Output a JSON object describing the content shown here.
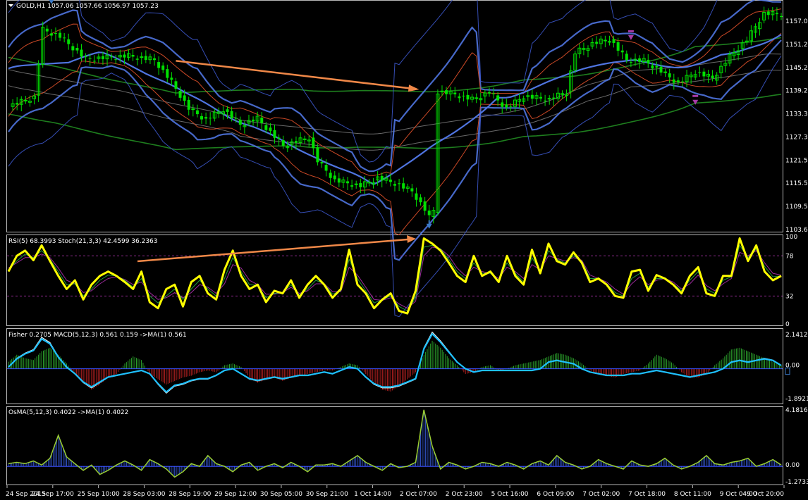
{
  "colors": {
    "background": "#000000",
    "panel_border": "#b8b8b8",
    "bull_candle": "#00e000",
    "bb_inner": "#4f74e0",
    "bb_outer": "#3b55c8",
    "bb_red": "#e0502a",
    "ma_long_green": "#1e7e1e",
    "ma_long_gray": "#6a6a6a",
    "arrow_orange": "#f08848",
    "rsi_yellow": "#ffff00",
    "stoch_green": "#1f9a3a",
    "stoch_purple": "#9a2a9a",
    "hist_pos": "#2ba02b",
    "hist_neg": "#b02020",
    "fisher_cyan": "#1ec0ff",
    "osma_line": "#9acd32",
    "osma_hist": "#3050c0",
    "zero_line": "#3a50ff",
    "level_line": "#8a2a8a"
  },
  "icons": [
    "dropdown-triangle-icon",
    "buy-arrow-icon",
    "sell-arrow-icon"
  ],
  "chart_data": [
    {
      "type": "candlestick",
      "title": "GOLD,H1  1057.06 1057.66 1056.97 1057.23",
      "yaxis_ticks": [
        "1157.09",
        "1151.29",
        "1145.29",
        "1139.29",
        "1133.39",
        "1127.39",
        "1121.59",
        "1115.59",
        "1109.59",
        "1103.69"
      ],
      "ylim": [
        1103.69,
        1160.5
      ],
      "close_path": [
        [
          0,
          1134.5
        ],
        [
          6,
          1136.8
        ],
        [
          8,
          1153.5
        ],
        [
          12,
          1151.8
        ],
        [
          18,
          1146.2
        ],
        [
          28,
          1147.0
        ],
        [
          34,
          1146.0
        ],
        [
          38,
          1140.5
        ],
        [
          42,
          1134.0
        ],
        [
          46,
          1131.2
        ],
        [
          50,
          1133.8
        ],
        [
          54,
          1130.0
        ],
        [
          58,
          1131.5
        ],
        [
          64,
          1124.8
        ],
        [
          70,
          1126.8
        ],
        [
          72,
          1121.0
        ],
        [
          76,
          1116.2
        ],
        [
          82,
          1114.8
        ],
        [
          86,
          1116.8
        ],
        [
          90,
          1115.5
        ],
        [
          94,
          1113.5
        ],
        [
          97,
          1109.0
        ],
        [
          98,
          1107.0
        ],
        [
          99,
          1108.8
        ],
        [
          100,
          1138.2
        ],
        [
          104,
          1137.5
        ],
        [
          108,
          1136.2
        ],
        [
          112,
          1138.0
        ],
        [
          116,
          1134.0
        ],
        [
          120,
          1137.0
        ],
        [
          126,
          1136.2
        ],
        [
          130,
          1138.2
        ],
        [
          132,
          1147.8
        ],
        [
          136,
          1150.0
        ],
        [
          140,
          1151.2
        ],
        [
          144,
          1146.0
        ],
        [
          148,
          1145.8
        ],
        [
          152,
          1143.2
        ],
        [
          156,
          1140.2
        ],
        [
          160,
          1143.0
        ],
        [
          164,
          1141.5
        ],
        [
          168,
          1146.8
        ],
        [
          172,
          1151.0
        ],
        [
          176,
          1157.5
        ],
        [
          180,
          1157.3
        ]
      ],
      "arrows": [
        {
          "kind": "buy",
          "x": 10,
          "y": 1159.5
        },
        {
          "kind": "buy",
          "x": 98,
          "y": 1103.9
        },
        {
          "kind": "sell",
          "x": 145,
          "y": 1152.5
        },
        {
          "kind": "sell",
          "x": 160,
          "y": 1136.5
        }
      ],
      "trend_annotation": {
        "from": [
          39,
          1145.8
        ],
        "to": [
          95,
          1138.8
        ]
      }
    },
    {
      "type": "line",
      "title": "RSI(5) 68.3993  Stoch(21,3,3) 42.4599 36.2363",
      "yaxis_ticks": [
        "100",
        "78",
        "32",
        "0"
      ],
      "ylim": [
        0,
        100
      ],
      "levels": [
        78,
        32
      ],
      "series": [
        {
          "name": "RSI(5)",
          "values": [
            60,
            78,
            84,
            73,
            90,
            72,
            55,
            40,
            50,
            28,
            45,
            55,
            60,
            55,
            48,
            40,
            60,
            25,
            18,
            40,
            45,
            20,
            48,
            55,
            35,
            28,
            62,
            84,
            55,
            40,
            45,
            25,
            38,
            35,
            50,
            30,
            45,
            55,
            45,
            30,
            40,
            85,
            45,
            35,
            18,
            28,
            35,
            15,
            12,
            38,
            98,
            92,
            84,
            70,
            55,
            48,
            78,
            55,
            60,
            48,
            78,
            55,
            45,
            85,
            58,
            92,
            72,
            68,
            82,
            70,
            48,
            52,
            45,
            32,
            30,
            60,
            62,
            38,
            56,
            52,
            45,
            35,
            55,
            65,
            35,
            32,
            55,
            55,
            98,
            72,
            90,
            60,
            50,
            55
          ]
        },
        {
          "name": "Stoch main",
          "values": [
            62,
            72,
            80,
            76,
            84,
            74,
            60,
            45,
            46,
            32,
            40,
            50,
            56,
            55,
            50,
            42,
            52,
            32,
            24,
            32,
            40,
            28,
            40,
            50,
            40,
            32,
            52,
            76,
            60,
            45,
            44,
            30,
            35,
            36,
            45,
            33,
            40,
            50,
            46,
            34,
            38,
            74,
            52,
            38,
            24,
            28,
            32,
            20,
            15,
            30,
            88,
            90,
            86,
            74,
            60,
            52,
            70,
            58,
            58,
            50,
            70,
            58,
            48,
            76,
            60,
            84,
            74,
            70,
            78,
            72,
            52,
            52,
            46,
            36,
            32,
            52,
            58,
            42,
            52,
            52,
            46,
            38,
            50,
            60,
            40,
            35,
            50,
            54,
            90,
            76,
            86,
            66,
            54,
            55
          ]
        },
        {
          "name": "Stoch signal",
          "values": [
            64,
            70,
            76,
            76,
            80,
            76,
            64,
            50,
            46,
            36,
            38,
            46,
            52,
            54,
            51,
            45,
            48,
            36,
            28,
            30,
            36,
            30,
            36,
            45,
            42,
            35,
            46,
            68,
            64,
            50,
            45,
            34,
            34,
            36,
            42,
            35,
            38,
            46,
            46,
            37,
            37,
            65,
            56,
            42,
            28,
            27,
            30,
            23,
            18,
            26,
            78,
            88,
            86,
            78,
            64,
            55,
            65,
            60,
            58,
            52,
            65,
            60,
            52,
            68,
            62,
            78,
            75,
            72,
            76,
            73,
            56,
            52,
            48,
            40,
            34,
            46,
            54,
            45,
            50,
            52,
            48,
            40,
            46,
            56,
            44,
            38,
            46,
            52,
            82,
            78,
            84,
            70,
            58,
            56
          ]
        }
      ]
    },
    {
      "type": "bar+line",
      "title": "Fisher 0.2705  MACD(5,12,3) 0.561 0.159  ->MA(1) 0.561",
      "yaxis_ticks": [
        "2.1412",
        "0.00",
        "-1.8921"
      ],
      "ylim": [
        -1.95,
        2.2
      ],
      "histogram": [
        0.4,
        0.8,
        0.6,
        0.5,
        1.0,
        1.2,
        0.8,
        0.3,
        -0.3,
        -0.8,
        -1.2,
        -0.9,
        -0.5,
        -0.3,
        0.3,
        0.7,
        0.5,
        -0.3,
        -0.6,
        -0.9,
        -0.7,
        -0.5,
        -0.4,
        -0.2,
        -0.1,
        -0.2,
        0.2,
        0.3,
        0.1,
        -0.5,
        -0.8,
        -0.6,
        -0.5,
        -0.7,
        -0.5,
        -0.4,
        -0.3,
        -0.2,
        -0.1,
        -0.1,
        0.1,
        0.3,
        0.2,
        -0.3,
        -0.8,
        -1.2,
        -1.3,
        -1.0,
        -0.6,
        -0.2,
        0.8,
        1.6,
        1.2,
        0.6,
        0.2,
        -0.3,
        -0.2,
        0.1,
        0.2,
        -0.1,
        0.0,
        0.2,
        0.3,
        0.4,
        0.5,
        0.7,
        0.9,
        0.8,
        0.6,
        0.3,
        -0.1,
        -0.3,
        -0.4,
        -0.5,
        -0.3,
        -0.2,
        -0.1,
        0.3,
        0.8,
        0.6,
        0.3,
        -0.2,
        -0.5,
        -0.5,
        -0.3,
        0.2,
        0.6,
        1.1,
        1.2,
        1.0,
        0.8,
        0.6,
        0.4,
        0.2
      ],
      "series": [
        {
          "name": "MACD",
          "values": [
            0.1,
            0.6,
            0.9,
            1.1,
            1.8,
            1.5,
            0.7,
            0.1,
            -0.3,
            -0.8,
            -1.1,
            -0.8,
            -0.5,
            -0.4,
            -0.3,
            -0.2,
            -0.1,
            -0.3,
            -0.9,
            -1.4,
            -1.0,
            -0.9,
            -0.7,
            -0.6,
            -0.6,
            -0.4,
            -0.1,
            0.0,
            -0.3,
            -0.6,
            -0.7,
            -0.6,
            -0.5,
            -0.6,
            -0.5,
            -0.4,
            -0.4,
            -0.3,
            -0.2,
            -0.3,
            -0.1,
            0.1,
            0.0,
            -0.5,
            -0.9,
            -1.1,
            -1.1,
            -1.0,
            -0.8,
            -0.6,
            1.2,
            2.1,
            1.6,
            1.0,
            0.4,
            0.0,
            -0.2,
            -0.1,
            -0.1,
            -0.1,
            -0.1,
            -0.1,
            -0.1,
            -0.1,
            0.0,
            0.4,
            0.5,
            0.4,
            0.3,
            0.0,
            -0.2,
            -0.3,
            -0.4,
            -0.4,
            -0.4,
            -0.3,
            -0.3,
            -0.2,
            -0.1,
            -0.2,
            -0.3,
            -0.4,
            -0.5,
            -0.4,
            -0.3,
            -0.2,
            0.0,
            0.4,
            0.5,
            0.4,
            0.5,
            0.6,
            0.5,
            0.2
          ]
        }
      ]
    },
    {
      "type": "bar+line",
      "title": "OsMA(5,12,3) 0.4022  ->MA(1) 0.4022",
      "yaxis_ticks": [
        "4.1816",
        "0.00",
        "-1.2733"
      ],
      "ylim": [
        -1.35,
        4.3
      ],
      "series": [
        {
          "name": "OsMA",
          "values": [
            0.2,
            0.3,
            0.2,
            0.4,
            0.1,
            0.6,
            2.3,
            0.7,
            0.2,
            -0.3,
            0.1,
            -0.6,
            -0.3,
            0.1,
            0.4,
            0.1,
            -0.3,
            0.5,
            0.2,
            -0.2,
            -0.8,
            -0.4,
            0.2,
            0.0,
            0.8,
            0.2,
            0.0,
            -0.4,
            0.1,
            0.3,
            -0.3,
            0.0,
            0.2,
            -0.1,
            0.3,
            0.0,
            -0.4,
            0.1,
            0.1,
            0.2,
            0.0,
            0.4,
            0.8,
            0.3,
            0.0,
            -0.3,
            0.2,
            -0.1,
            0.0,
            0.3,
            4.2,
            1.5,
            -0.2,
            0.3,
            0.1,
            -0.2,
            0.0,
            0.3,
            0.2,
            0.0,
            0.3,
            0.1,
            -0.2,
            0.2,
            0.4,
            0.1,
            0.8,
            0.3,
            0.1,
            -0.2,
            0.0,
            0.5,
            0.2,
            0.0,
            -0.2,
            0.4,
            0.1,
            0.0,
            0.2,
            0.6,
            0.1,
            -0.2,
            0.0,
            0.3,
            0.8,
            0.2,
            0.1,
            0.3,
            0.4,
            0.6,
            0.0,
            0.2,
            0.5,
            0.1
          ]
        }
      ]
    }
  ],
  "xaxis_ticks": [
    "24 Sep 2015",
    "24 Sep 17:00",
    "25 Sep 10:00",
    "28 Sep 03:00",
    "28 Sep 19:00",
    "29 Sep 12:00",
    "30 Sep 05:00",
    "30 Sep 21:00",
    "1 Oct 14:00",
    "2 Oct 07:00",
    "2 Oct 23:00",
    "5 Oct 16:00",
    "6 Oct 09:00",
    "7 Oct 02:00",
    "7 Oct 18:00",
    "8 Oct 11:00",
    "9 Oct 04:00",
    "9 Oct 20:00"
  ]
}
